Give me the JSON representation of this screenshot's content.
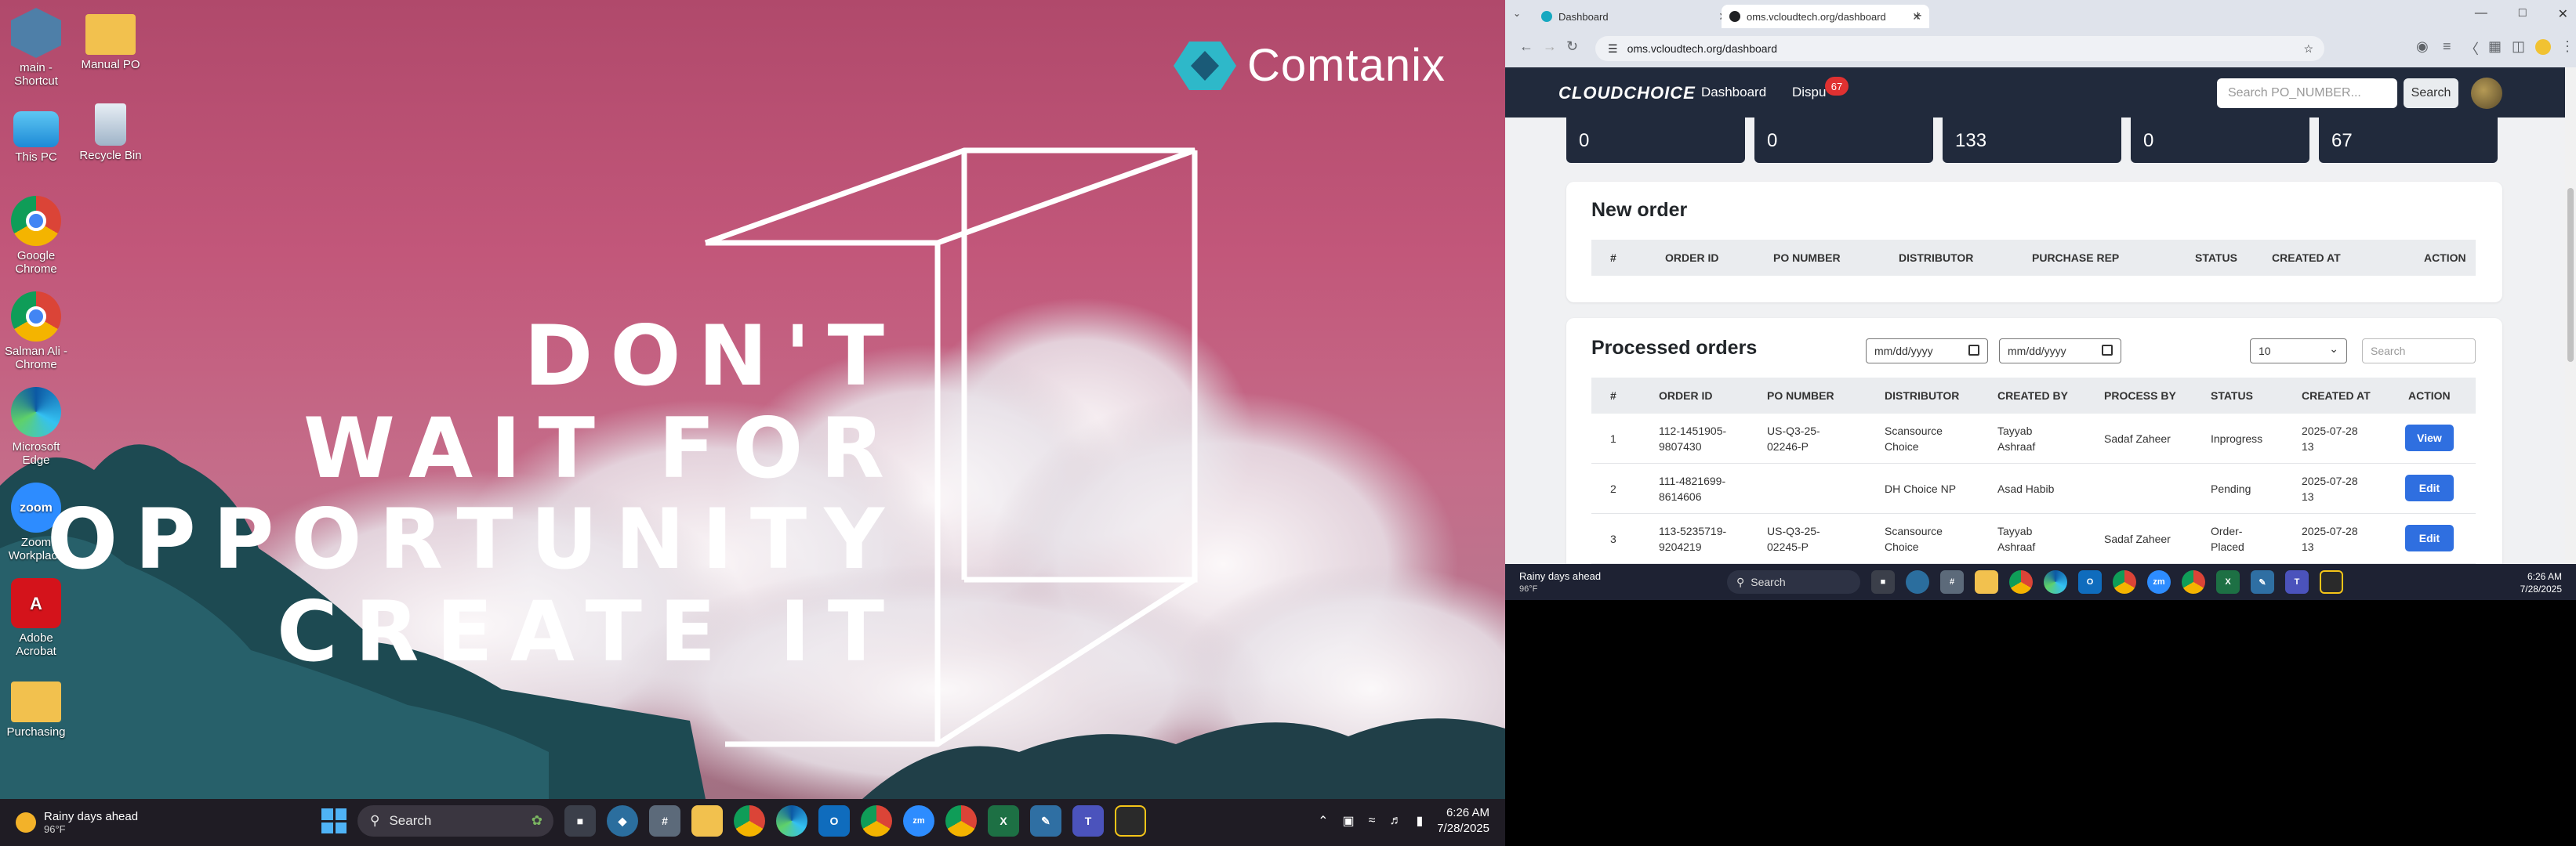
{
  "desktop": {
    "icons": [
      {
        "label": "main - Shortcut",
        "icon": "shortcut-icon"
      },
      {
        "label": "Manual PO",
        "icon": "folder-icon"
      },
      {
        "label": "This PC",
        "icon": "monitor-icon"
      },
      {
        "label": "Recycle Bin",
        "icon": "recycle-bin-icon"
      },
      {
        "label": "Google Chrome",
        "icon": "chrome-icon"
      },
      {
        "label": "Salman Ali - Chrome",
        "icon": "chrome-icon"
      },
      {
        "label": "Microsoft Edge",
        "icon": "edge-icon"
      },
      {
        "label": "Zoom Workplace",
        "icon": "zoom-icon"
      },
      {
        "label": "Adobe Acrobat",
        "icon": "acrobat-icon"
      },
      {
        "label": "Purchasing",
        "icon": "folder-icon"
      }
    ],
    "brand": "Comtanix",
    "quote": [
      "DON'T",
      "WAIT FOR",
      "OPPORTUNITY",
      "CREATE IT"
    ],
    "wallpaper_color": "#c2577a"
  },
  "left_taskbar": {
    "weather_title": "Rainy days ahead",
    "weather_temp": "96°F",
    "search": "Search",
    "time": "6:26 AM",
    "date": "7/28/2025"
  },
  "browser": {
    "tabs": [
      {
        "title": "Dashboard",
        "active": false
      },
      {
        "title": "oms.vcloudtech.org/dashboard",
        "active": true
      }
    ],
    "url": "oms.vcloudtech.org/dashboard"
  },
  "app": {
    "logo": "CLOUDCHOICE",
    "nav": [
      "Dashboard",
      "Dispu"
    ],
    "badge": "67",
    "search_placeholder": "Search PO_NUMBER...",
    "search_button": "Search",
    "accent": "#2f6fe0",
    "navbar_color": "#212a3c",
    "stats": [
      {
        "value": "0"
      },
      {
        "value": "0"
      },
      {
        "value": "133"
      },
      {
        "value": "0"
      },
      {
        "value": "67"
      }
    ],
    "new_order": {
      "title": "New order",
      "columns": [
        "#",
        "ORDER ID",
        "PO NUMBER",
        "DISTRIBUTOR",
        "PURCHASE REP",
        "STATUS",
        "CREATED AT",
        "ACTION"
      ]
    },
    "processed": {
      "title": "Processed orders",
      "date_from": "mm/dd/yyyy",
      "date_to": "mm/dd/yyyy",
      "page_size": "10",
      "search_placeholder": "Search",
      "columns": [
        "#",
        "ORDER ID",
        "PO NUMBER",
        "DISTRIBUTOR",
        "CREATED BY",
        "PROCESS BY",
        "STATUS",
        "CREATED AT",
        "ACTION"
      ],
      "rows": [
        {
          "n": "1",
          "order_id": "112-1451905-\n9807430",
          "po": "US-Q3-25-\n02246-P",
          "distributor": "Scansource\nChoice",
          "created_by": "Tayyab\nAshraaf",
          "process_by": "Sadaf Zaheer",
          "status": "Inprogress",
          "created_at": "2025-07-28\n13",
          "action": "View"
        },
        {
          "n": "2",
          "order_id": "111-4821699-\n8614606",
          "po": "",
          "distributor": "DH Choice NP",
          "created_by": "Asad Habib",
          "process_by": "",
          "status": "Pending",
          "created_at": "2025-07-28\n13",
          "action": "Edit"
        },
        {
          "n": "3",
          "order_id": "113-5235719-\n9204219",
          "po": "US-Q3-25-\n02245-P",
          "distributor": "Scansource\nChoice",
          "created_by": "Tayyab\nAshraaf",
          "process_by": "Sadaf Zaheer",
          "status": "Order-\nPlaced",
          "created_at": "2025-07-28\n13",
          "action": "Edit"
        }
      ]
    }
  },
  "right_taskbar": {
    "weather_title": "Rainy days ahead",
    "weather_temp": "96°F",
    "search": "Search",
    "time": "6:26 AM",
    "date": "7/28/2025"
  }
}
